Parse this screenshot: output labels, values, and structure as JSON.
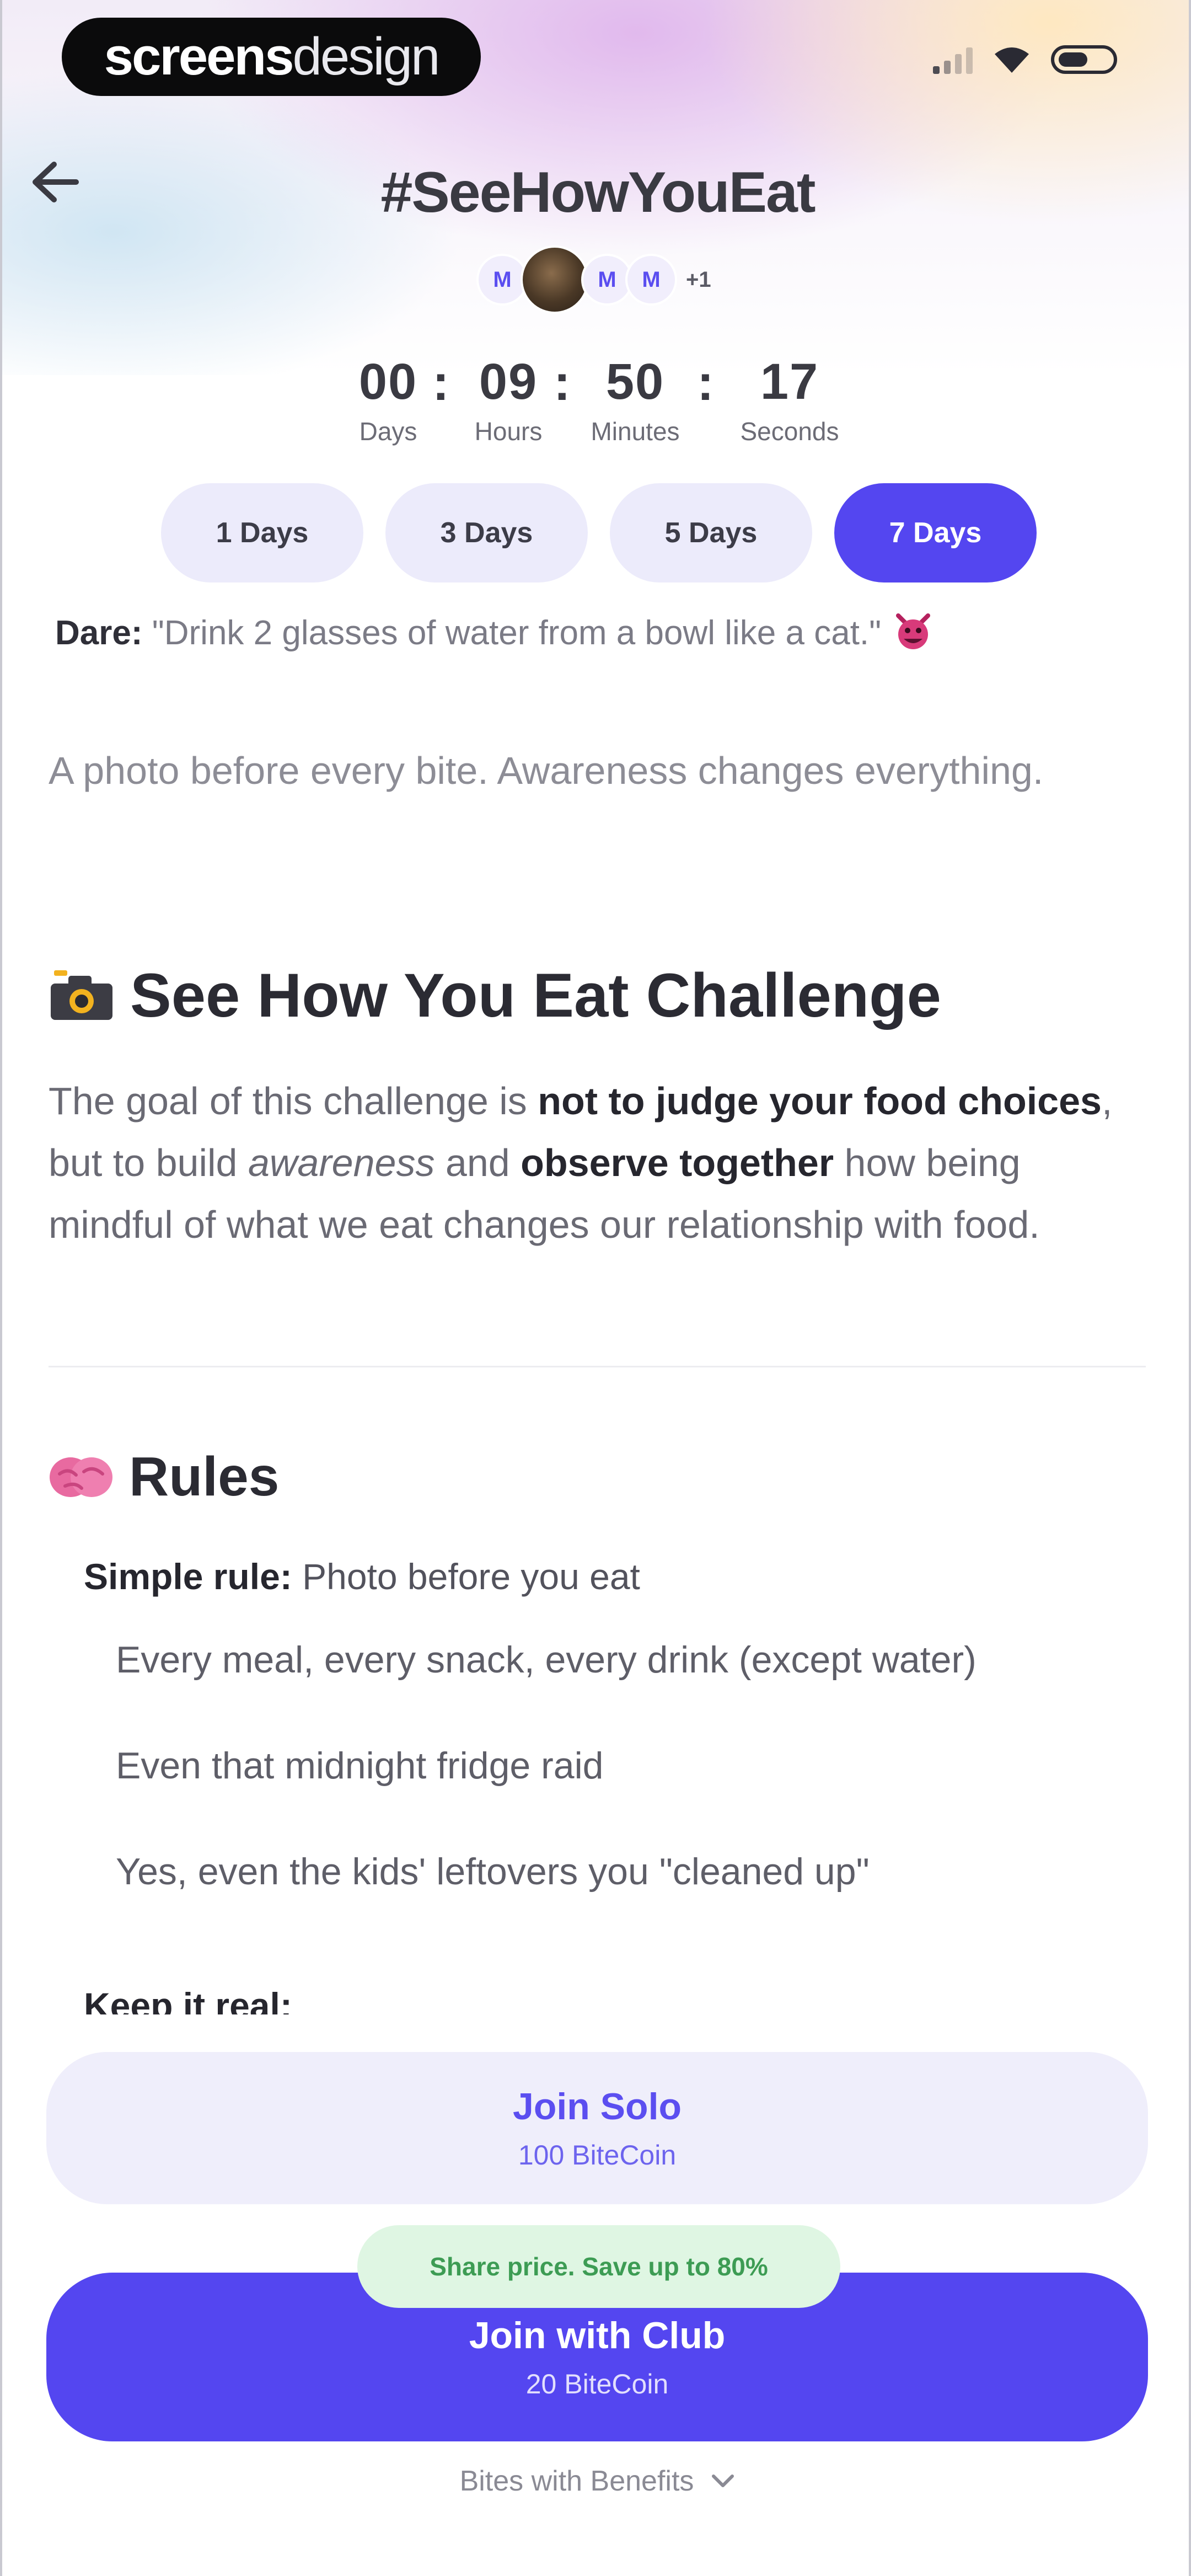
{
  "status_bar": {
    "brand_bold": "screens",
    "brand_light": "design"
  },
  "nav": {
    "title": "#SeeHowYouEat"
  },
  "participants": {
    "avatars": [
      "M",
      "",
      "M",
      "M"
    ],
    "more": "+1"
  },
  "countdown": {
    "days": "00",
    "hours": "09",
    "minutes": "50",
    "seconds": "17",
    "separator": ":",
    "labels": {
      "days": "Days",
      "hours": "Hours",
      "minutes": "Minutes",
      "seconds": "Seconds"
    }
  },
  "durations": [
    {
      "label": "1 Days",
      "active": false
    },
    {
      "label": "3 Days",
      "active": false
    },
    {
      "label": "5 Days",
      "active": false
    },
    {
      "label": "7 Days",
      "active": true
    }
  ],
  "dare": {
    "prefix": "Dare:",
    "text": "\"Drink 2 glasses of water from a bowl like a cat.\"",
    "emoji": "devil-face-icon"
  },
  "tagline": "A photo before every bite. Awareness changes everything.",
  "challenge": {
    "title": "See How You Eat Challenge",
    "icon": "camera-icon",
    "goal_parts": {
      "p1": "The goal of this challenge is ",
      "b1": "not to judge your food choices",
      "p2": ", but to build ",
      "i1": "awareness",
      "p3": " and ",
      "b2": "observe together",
      "p4": " how being mindful of what we eat changes our relationship with food."
    }
  },
  "rules": {
    "title": "Rules",
    "icon": "brain-icon",
    "simple_prefix": "Simple rule:",
    "simple_text": "Photo before you eat",
    "items": [
      "Every meal, every snack, every drink (except water)",
      "Even that midnight fridge raid",
      "Yes, even the kids' leftovers you \"cleaned up\""
    ],
    "keep_real": "Keep it real:"
  },
  "actions": {
    "solo_label": "Join Solo",
    "solo_price": "100 BiteCoin",
    "promo": "Share price. Save up to 80%",
    "club_label": "Join with Club",
    "club_price": "20 BiteCoin",
    "benefits_link": "Bites with Benefits"
  },
  "colors": {
    "accent": "#5446f0",
    "accent_light": "#ecebfb",
    "promo_bg": "#dff6e3",
    "promo_text": "#3d9c54"
  }
}
